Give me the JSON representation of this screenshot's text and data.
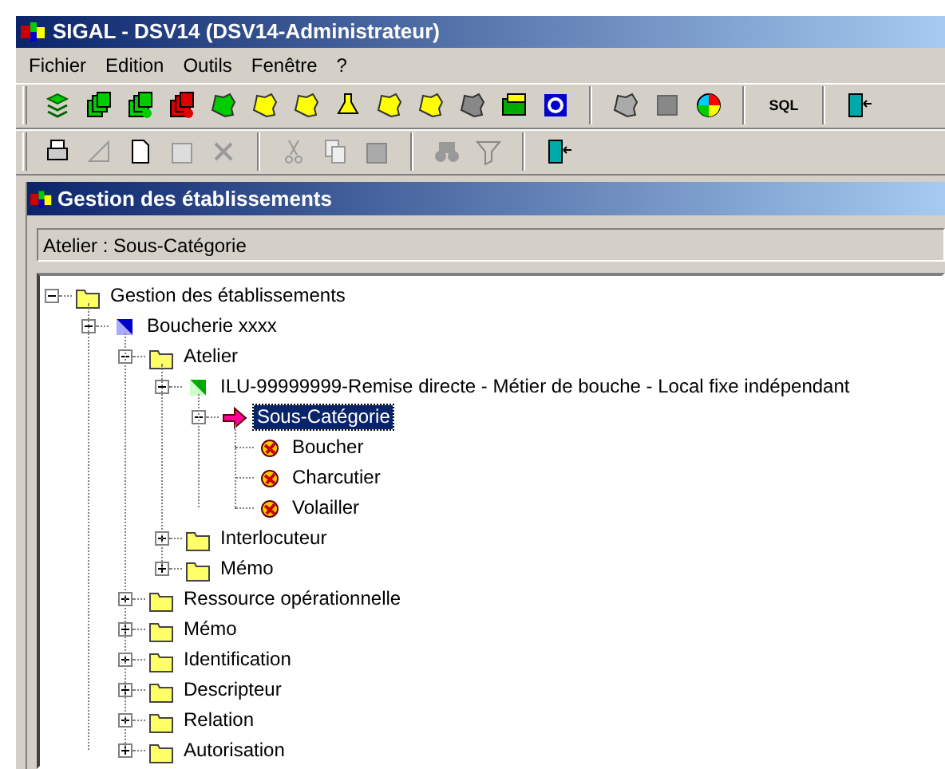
{
  "window": {
    "title": "SIGAL - DSV14 (DSV14-Administrateur)"
  },
  "menu": [
    "Fichier",
    "Edition",
    "Outils",
    "Fenêtre",
    "?"
  ],
  "toolbar": {
    "sql_button": "SQL"
  },
  "child_window": {
    "title": "Gestion des établissements"
  },
  "path_field": {
    "value": "Atelier : Sous-Catégorie"
  },
  "tree": [
    {
      "label": "Gestion des établissements",
      "kind": "folder",
      "expanded": true,
      "selected": false,
      "children": [
        {
          "label": "Boucherie xxxx",
          "kind": "establishment",
          "expanded": true,
          "selected": false,
          "children": [
            {
              "label": "Atelier",
              "kind": "folder",
              "expanded": true,
              "selected": false,
              "children": [
                {
                  "label": "ILU-99999999-Remise directe - Métier de bouche - Local fixe indépendant",
                  "kind": "activity",
                  "expanded": true,
                  "selected": false,
                  "children": [
                    {
                      "label": "Sous-Catégorie",
                      "kind": "arrow",
                      "expanded": true,
                      "selected": true,
                      "children": [
                        {
                          "label": "Boucher",
                          "kind": "category",
                          "selected": false
                        },
                        {
                          "label": "Charcutier",
                          "kind": "category",
                          "selected": false
                        },
                        {
                          "label": "Volailler",
                          "kind": "category",
                          "selected": false
                        }
                      ]
                    }
                  ]
                },
                {
                  "label": "Interlocuteur",
                  "kind": "folder",
                  "expanded": false,
                  "selected": false
                },
                {
                  "label": "Mémo",
                  "kind": "folder",
                  "expanded": false,
                  "selected": false
                }
              ]
            },
            {
              "label": "Ressource opérationnelle",
              "kind": "folder",
              "expanded": false,
              "selected": false
            },
            {
              "label": "Mémo",
              "kind": "folder",
              "expanded": false,
              "selected": false
            },
            {
              "label": "Identification",
              "kind": "folder",
              "expanded": false,
              "selected": false
            },
            {
              "label": "Descripteur",
              "kind": "folder",
              "expanded": false,
              "selected": false
            },
            {
              "label": "Relation",
              "kind": "folder",
              "expanded": false,
              "selected": false
            },
            {
              "label": "Autorisation",
              "kind": "folder",
              "expanded": false,
              "selected": false
            }
          ]
        }
      ]
    }
  ]
}
